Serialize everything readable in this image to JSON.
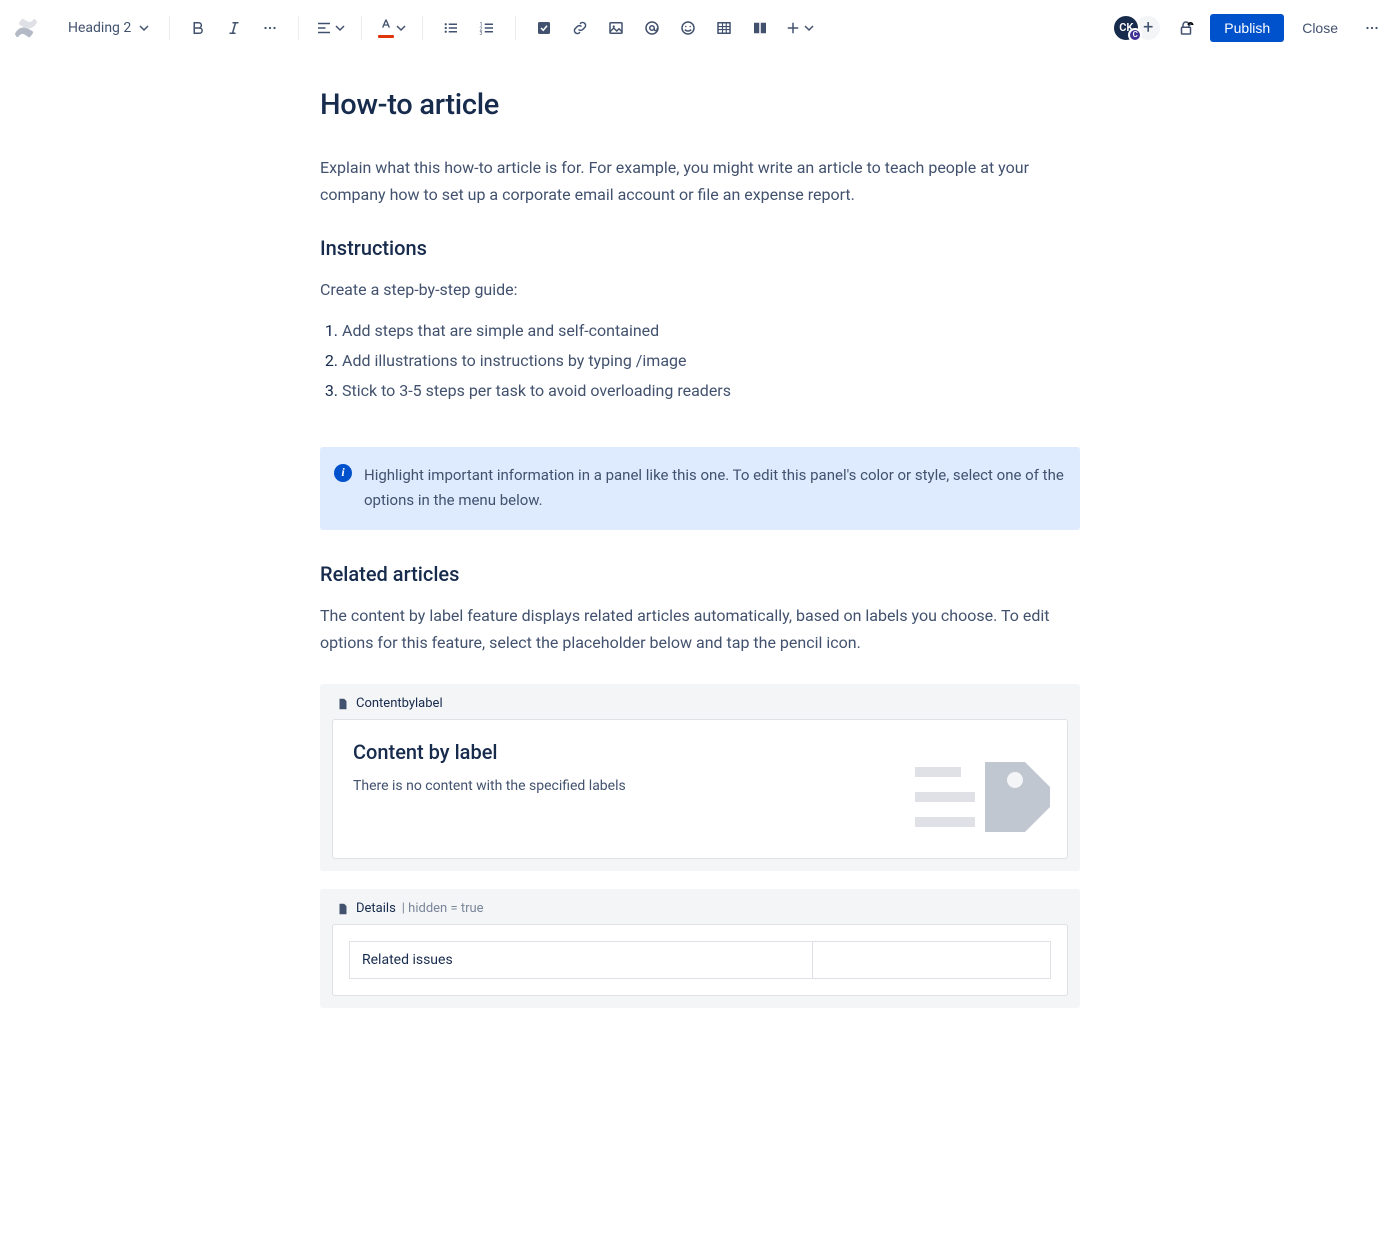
{
  "toolbar": {
    "heading_style": "Heading 2",
    "avatar_initials": "CK",
    "avatar_badge": "C",
    "publish_label": "Publish",
    "close_label": "Close"
  },
  "page": {
    "title": "How-to article",
    "intro": "Explain what this how-to article is for. For example, you might write an article to teach people at your company how to set up a corporate email account or file an expense report.",
    "instructions_heading": "Instructions",
    "instructions_lead": "Create a step-by-step guide:",
    "steps": [
      "Add steps that are simple and self-contained",
      "Add illustrations to instructions by typing /image",
      "Stick to 3-5 steps per task to avoid overloading readers"
    ],
    "panel_text": "Highlight important information in a panel like this one. To edit this panel's color or style, select one of the options in the menu below.",
    "related_heading": "Related articles",
    "related_intro": "The content by label feature displays related articles automatically, based on labels you choose. To edit options for this feature, select the placeholder below and tap the pencil icon.",
    "content_by_label": {
      "macro_name": "Contentbylabel",
      "title": "Content by label",
      "empty_text": "There is no content with the specified labels"
    },
    "details": {
      "macro_name": "Details",
      "meta": "| hidden = true",
      "row_label": "Related issues"
    }
  }
}
